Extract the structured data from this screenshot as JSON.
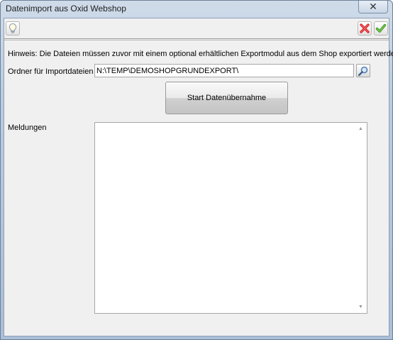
{
  "window": {
    "title": "Datenimport aus Oxid Webshop",
    "close_glyph": "✕"
  },
  "toolbar": {
    "left_icon": "lightbulb-icon",
    "cancel_icon": "red-x-icon",
    "confirm_icon": "green-check-icon"
  },
  "form": {
    "hint": "Hinweis: Die Dateien müssen zuvor mit einem optional erhältlichen Exportmodul aus dem Shop exportiert werden.",
    "folder_label": "Ordner für Importdateien",
    "folder_value": "N:\\TEMP\\DEMOSHOPGRUNDEXPORT\\",
    "start_button": "Start Datenübernahme",
    "messages_label": "Meldungen",
    "messages_text": ""
  },
  "colors": {
    "cancel": "#d8282a",
    "confirm": "#3f9c1f"
  }
}
